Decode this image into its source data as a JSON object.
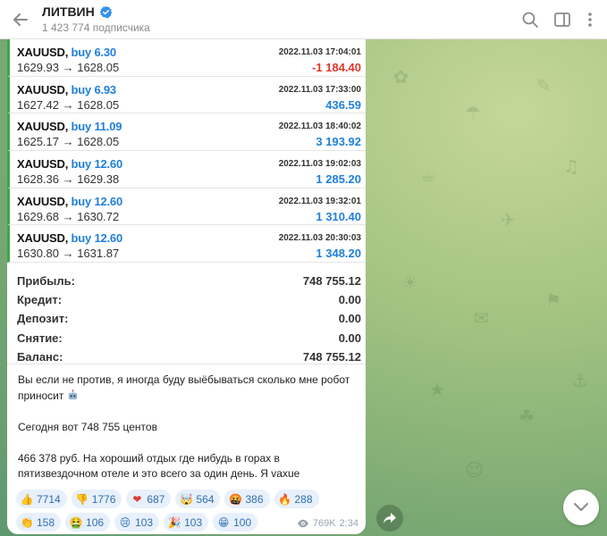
{
  "header": {
    "title": "ЛИТВИН",
    "subscribers": "1 423 774 подписчика"
  },
  "trades": [
    {
      "symbol": "XAUUSD,",
      "direction": "buy 6.30",
      "prices": "1629.93 → 1628.05",
      "time": "2022.11.03 17:04:01",
      "profit": "-1 184.40",
      "negative": true
    },
    {
      "symbol": "XAUUSD,",
      "direction": "buy 6.93",
      "prices": "1627.42 → 1628.05",
      "time": "2022.11.03 17:33:00",
      "profit": "436.59",
      "negative": false
    },
    {
      "symbol": "XAUUSD,",
      "direction": "buy 11.09",
      "prices": "1625.17 → 1628.05",
      "time": "2022.11.03 18:40:02",
      "profit": "3 193.92",
      "negative": false
    },
    {
      "symbol": "XAUUSD,",
      "direction": "buy 12.60",
      "prices": "1628.36 → 1629.38",
      "time": "2022.11.03 19:02:03",
      "profit": "1 285.20",
      "negative": false
    },
    {
      "symbol": "XAUUSD,",
      "direction": "buy 12.60",
      "prices": "1629.68 → 1630.72",
      "time": "2022.11.03 19:32:01",
      "profit": "1 310.40",
      "negative": false
    },
    {
      "symbol": "XAUUSD,",
      "direction": "buy 12.60",
      "prices": "1630.80 → 1631.87",
      "time": "2022.11.03 20:30:03",
      "profit": "1 348.20",
      "negative": false
    }
  ],
  "summary": [
    {
      "label": "Прибыль:",
      "value": "748 755.12"
    },
    {
      "label": "Кредит:",
      "value": "0.00"
    },
    {
      "label": "Депозит:",
      "value": "0.00"
    },
    {
      "label": "Снятие:",
      "value": "0.00"
    },
    {
      "label": "Баланс:",
      "value": "748 755.12"
    }
  ],
  "message": {
    "paragraph1": "Вы если не против, я иногда буду выёбываться сколько мне робот приносит",
    "paragraph2": "Сегодня вот 748 755 центов",
    "paragraph3": "466 378 руб. На хороший отдых где нибудь в горах в пятизвездочном отеле и это всего за один день. Я vaxue"
  },
  "reactions": [
    {
      "emoji": "👍",
      "count": "7714",
      "bg": "#f7c948"
    },
    {
      "emoji": "👎",
      "count": "1776",
      "bg": "#f7c948"
    },
    {
      "emoji": "❤",
      "count": "687",
      "bg": "#e23b3b"
    },
    {
      "emoji": "🤯",
      "count": "564",
      "bg": "#f2a33c"
    },
    {
      "emoji": "🤬",
      "count": "386",
      "bg": "#d8402f"
    },
    {
      "emoji": "🔥",
      "count": "288",
      "bg": "#f07b2c"
    },
    {
      "emoji": "👏",
      "count": "158",
      "bg": "#f7c948"
    },
    {
      "emoji": "🤮",
      "count": "106",
      "bg": "#a8c44a"
    },
    {
      "emoji": "😢",
      "count": "103",
      "bg": "#f7c948"
    },
    {
      "emoji": "🎉",
      "count": "103",
      "bg": "#f2a33c"
    },
    {
      "emoji": "😁",
      "count": "100",
      "bg": "#f7c948"
    }
  ],
  "meta": {
    "views": "769K",
    "time": "2:34"
  },
  "colors": {
    "accent": "#1f7fdc",
    "negative": "#e0352b",
    "positive_bar": "#3ea84a"
  }
}
